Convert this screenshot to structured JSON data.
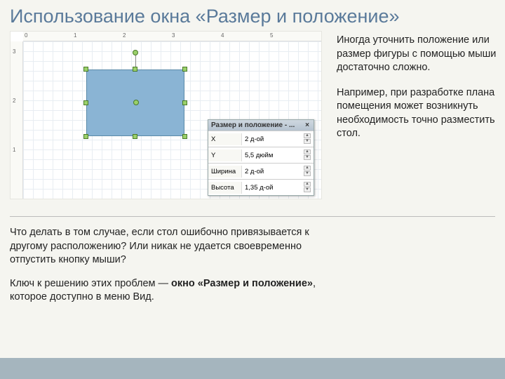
{
  "title": "Использование окна «Размер и положение»",
  "ruler_h": [
    "0",
    "1",
    "2",
    "3",
    "4",
    "5"
  ],
  "ruler_v": [
    "3",
    "2",
    "1"
  ],
  "panel": {
    "title": "Размер и положение - ...",
    "rows": [
      {
        "label": "X",
        "value": "2 д-ой"
      },
      {
        "label": "Y",
        "value": "5,5 дюйм"
      },
      {
        "label": "Ширина",
        "value": "2 д-ой"
      },
      {
        "label": "Высота",
        "value": "1,35 д-ой"
      }
    ]
  },
  "right": {
    "p1": "Иногда уточнить положение или размер фигуры с помощью мыши достаточно сложно.",
    "p2": "Например, при разработке плана помещения может возникнуть необходимость точно разместить стол."
  },
  "bottom": {
    "p1": "Что делать в том случае, если стол ошибочно привязывается к другому расположению? Или никак не удается своевременно отпустить кнопку мыши?",
    "p2a": "Ключ к решению этих проблем — ",
    "p2b": "окно «Размер и положение»",
    "p2c": ", которое доступно в меню Вид."
  }
}
